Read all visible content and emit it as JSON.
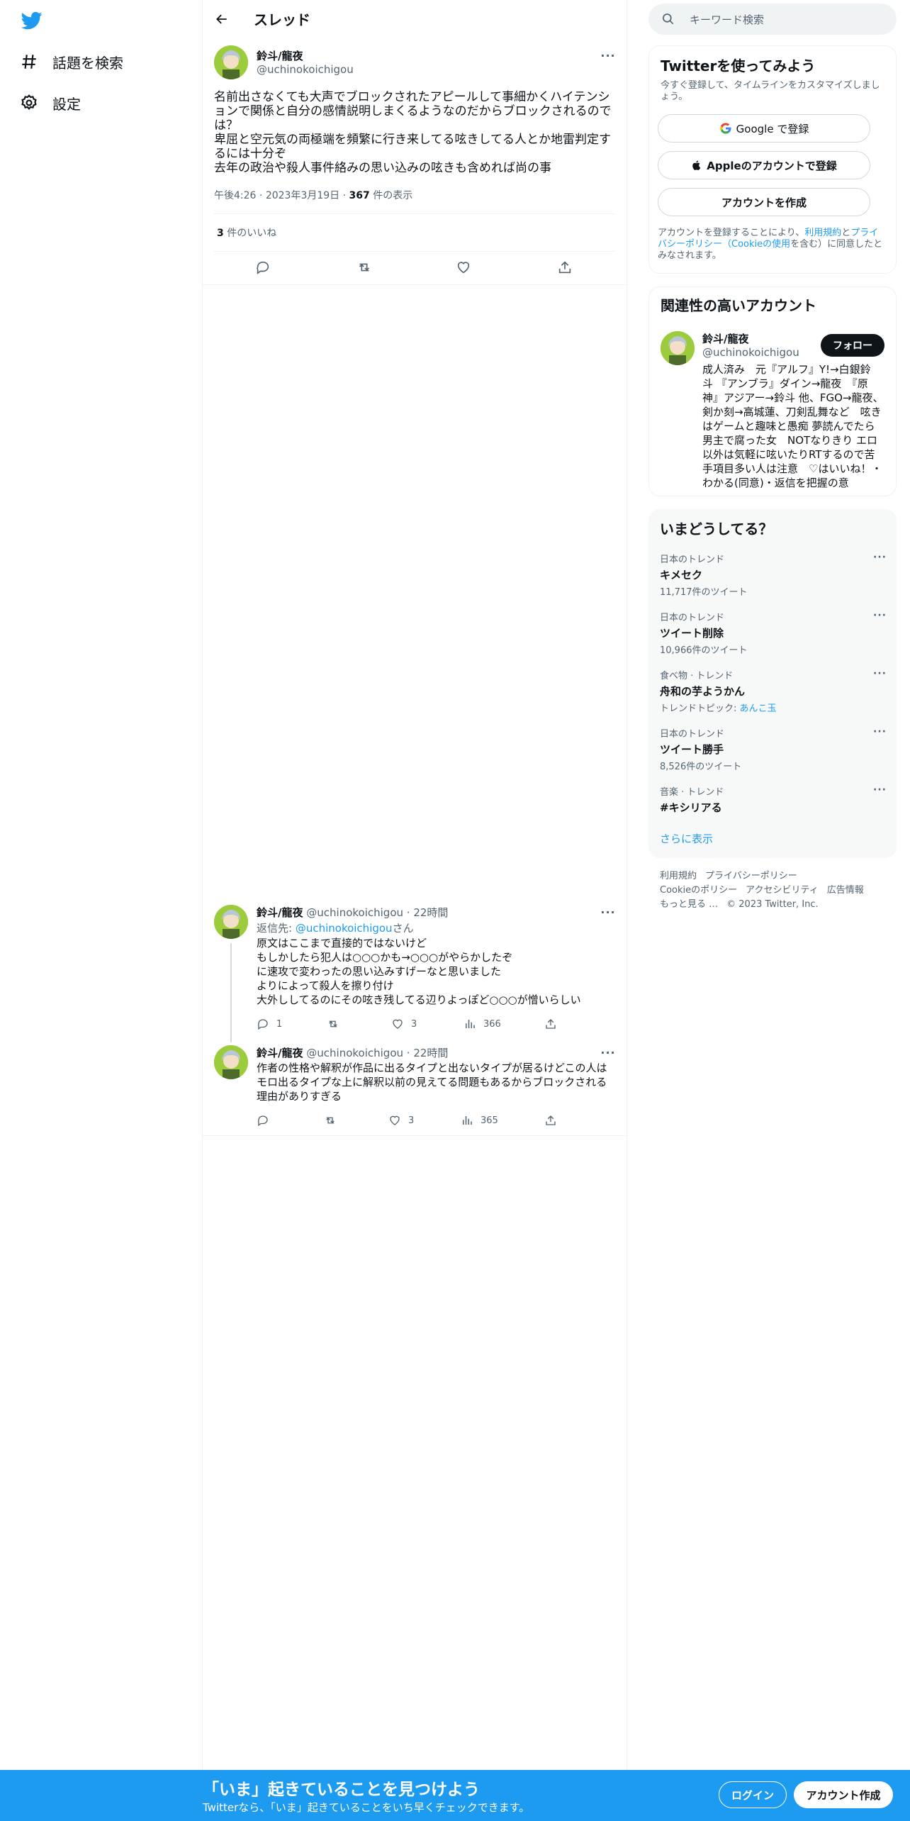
{
  "nav": {
    "explore_label": "話題を検索",
    "settings_label": "設定"
  },
  "header": {
    "title": "スレッド"
  },
  "main_tweet": {
    "name": "鈴斗/龍夜",
    "handle": "@uchinokoichigou",
    "text_lines": [
      "名前出さなくても大声でブロックされたアピールして事細かくハイテンシ",
      "ョンで関係と自分の感情説明しまくるようなのだからブロックされるので",
      "は？",
      "卑屈と空元気の両極端を頻繁に行き来してる呟きしてる人とか地雷判定す",
      "るには十分ぞ",
      "去年の政治や殺人事件絡みの思い込みの呟きも含めれば尚の事"
    ],
    "time": "午後4:26",
    "date": "2023年3月19日",
    "views": "367",
    "views_label": "件の表示",
    "likes": "3",
    "likes_label": "件のいいね"
  },
  "replies": [
    {
      "name": "鈴斗/龍夜",
      "handle": "@uchinokoichigou",
      "time": "22時間",
      "reply_prefix": "返信先: ",
      "reply_to": "@uchinokoichigou",
      "reply_suffix": "さん",
      "text_lines": [
        "原文はここまで直接的ではないけど",
        "もしかしたら犯人は○○○かも→○○○がやらかしたぞ",
        "に速攻で変わったの思い込みすげーなと思いました",
        "よりによって殺人を擦り付け",
        "大外ししてるのにその呟き残してる辺りよっぽど○○○が憎いらしい"
      ],
      "replies": "1",
      "retweets": "",
      "likes": "3",
      "views": "366"
    },
    {
      "name": "鈴斗/龍夜",
      "handle": "@uchinokoichigou",
      "time": "22時間",
      "text_lines": [
        "作者の性格や解釈が作品に出るタイプと出ないタイプが居るけどこの人は",
        "モロ出るタイプな上に解釈以前の見えてる問題もあるからブロックされる",
        "理由がありすぎる"
      ],
      "replies": "",
      "retweets": "",
      "likes": "3",
      "views": "365"
    }
  ],
  "search": {
    "placeholder": "キーワード検索"
  },
  "signup_card": {
    "title": "Twitterを使ってみよう",
    "subtitle_lines": [
      "今すぐ登録して、タイムラインをカスタマイズしまし",
      "ょう。"
    ],
    "google_label": "Google で登録",
    "apple_label": "Appleのアカウントで登録",
    "create_label": "アカウントを作成",
    "legal_1": "アカウントを登録することにより、",
    "legal_terms": "利用規約",
    "legal_and": "と",
    "legal_privacy_a": "プライ",
    "legal_privacy_b": "バシーポリシー",
    "legal_cookie": "（Cookieの使用",
    "legal_2": "を含む）に同意したと",
    "legal_3": "みなされます。"
  },
  "related": {
    "title": "関連性の高いアカウント",
    "name": "鈴斗/龍夜",
    "handle": "@uchinokoichigou",
    "follow_label": "フォロー",
    "bio_lines": [
      "成人済み　元『アルフ』Y!→白銀鈴",
      "斗 『アンブラ』ダイン→龍夜　『原",
      "神』アジアー→鈴斗 他、FGO→龍夜、",
      "剣か刻→高城蓮、刀剣乱舞など　呟き",
      "はゲームと趣味と愚痴 夢読んでたら",
      "男主で腐った女　NOTなりきり エロ",
      "以外は気軽に呟いたりRTするので苦",
      "手項目多い人は注意　♡はいいね！・",
      "わかる(同意)・返信を把握の意"
    ]
  },
  "trends": {
    "title": "いまどうしてる？",
    "items": [
      {
        "category": "日本のトレンド",
        "name": "キメセク",
        "count": "11,717件のツイート"
      },
      {
        "category": "日本のトレンド",
        "name": "ツイート削除",
        "count": "10,966件のツイート"
      },
      {
        "category": "食べ物 · トレンド",
        "name": "舟和の芋ようかん",
        "topic_prefix": "トレンドトピック: ",
        "topic": "あんこ玉"
      },
      {
        "category": "日本のトレンド",
        "name": "ツイート勝手",
        "count": "8,526件のツイート"
      },
      {
        "category": "音楽 · トレンド",
        "name": "#キシリアる"
      }
    ],
    "show_more": "さらに表示"
  },
  "footer": {
    "terms": "利用規約",
    "privacy": "プライバシーポリシー",
    "cookie": "Cookieのポリシー",
    "accessibility": "アクセシビリティ",
    "ads": "広告情報",
    "more": "もっと見る …",
    "copyright": "© 2023 Twitter, Inc."
  },
  "bottom_bar": {
    "title": "「いま」起きていることを見つけよう",
    "subtitle": "Twitterなら、「いま」起きていることをいち早くチェックできます。",
    "login_label": "ログイン",
    "signup_label": "アカウント作成"
  },
  "colors": {
    "brand": "#1d9bf0",
    "text": "#0f1419",
    "muted": "#536471"
  }
}
